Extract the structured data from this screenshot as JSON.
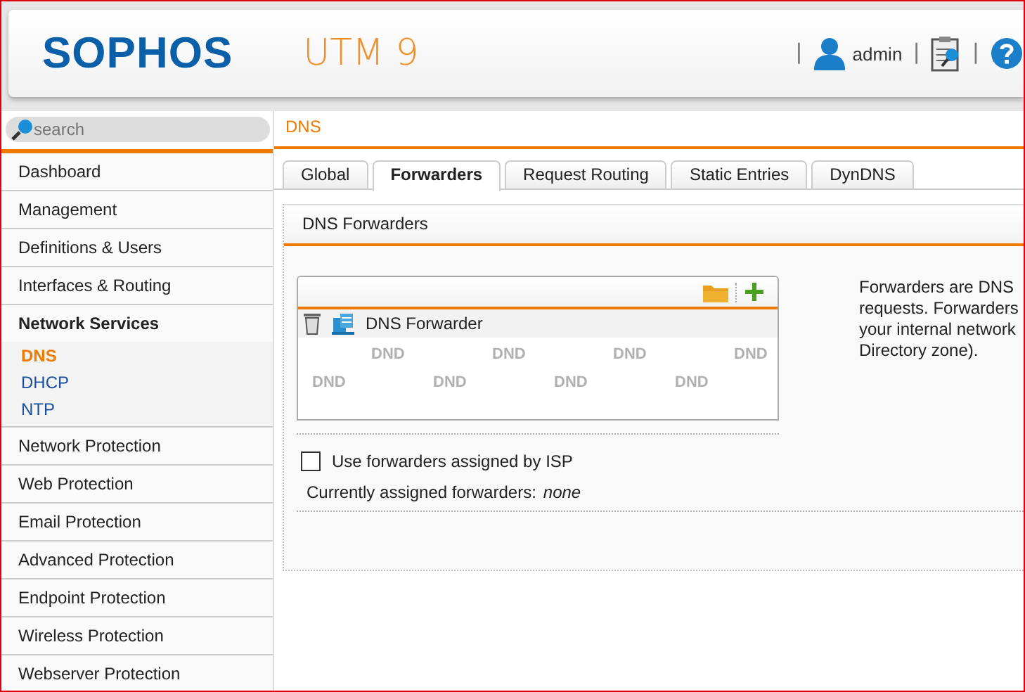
{
  "header": {
    "logo": "SOPHOS",
    "product": "UTM 9",
    "user": "admin",
    "separator": "|"
  },
  "search": {
    "placeholder": "search"
  },
  "page_title": "DNS",
  "sidebar": {
    "items": [
      {
        "label": "Dashboard",
        "expanded": false
      },
      {
        "label": "Management",
        "expanded": false
      },
      {
        "label": "Definitions & Users",
        "expanded": false
      },
      {
        "label": "Interfaces & Routing",
        "expanded": false
      },
      {
        "label": "Network Services",
        "expanded": true,
        "children": [
          {
            "label": "DNS",
            "selected": true
          },
          {
            "label": "DHCP",
            "selected": false
          },
          {
            "label": "NTP",
            "selected": false
          }
        ]
      },
      {
        "label": "Network Protection",
        "expanded": false
      },
      {
        "label": "Web Protection",
        "expanded": false
      },
      {
        "label": "Email Protection",
        "expanded": false
      },
      {
        "label": "Advanced Protection",
        "expanded": false
      },
      {
        "label": "Endpoint Protection",
        "expanded": false
      },
      {
        "label": "Wireless Protection",
        "expanded": false
      },
      {
        "label": "Webserver Protection",
        "expanded": false
      }
    ]
  },
  "tabs": [
    {
      "label": "Global",
      "selected": false
    },
    {
      "label": "Forwarders",
      "selected": true
    },
    {
      "label": "Request Routing",
      "selected": false
    },
    {
      "label": "Static Entries",
      "selected": false
    },
    {
      "label": "DynDNS",
      "selected": false
    }
  ],
  "panel": {
    "title": "DNS Forwarders",
    "list": {
      "items": [
        {
          "label": "DNS Forwarder"
        }
      ],
      "drop_hint": [
        "DND",
        "DND",
        "DND",
        "DND",
        "DND",
        "DND",
        "DND",
        "DND"
      ]
    },
    "isp_checkbox": {
      "label": "Use forwarders assigned by ISP",
      "checked": false
    },
    "assigned": {
      "label": "Currently assigned forwarders:",
      "value": "none"
    },
    "help_lines": [
      "Forwarders are DNS",
      "requests. Forwarders",
      "your internal network",
      "Directory zone)."
    ]
  }
}
